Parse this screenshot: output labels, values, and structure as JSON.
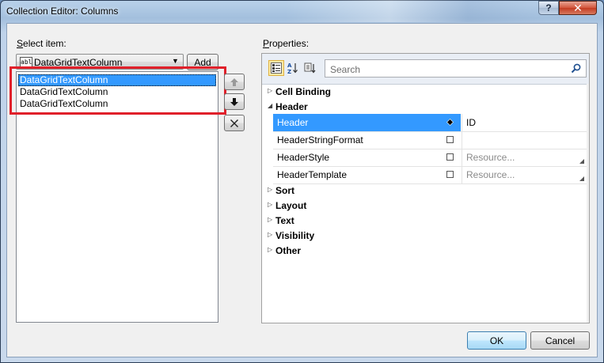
{
  "window": {
    "title": "Collection Editor: Columns",
    "help_label": "?",
    "close_label": "✕"
  },
  "left": {
    "select_label_first": "S",
    "select_label_rest": "elect item:",
    "combo_icon_text": "abl",
    "combo_value": "DataGridTextColumn",
    "add_label": "Add",
    "items": [
      {
        "label": "DataGridTextColumn",
        "selected": true
      },
      {
        "label": "DataGridTextColumn",
        "selected": false
      },
      {
        "label": "DataGridTextColumn",
        "selected": false
      }
    ],
    "highlight_color": "#e0202a"
  },
  "right": {
    "properties_label_first": "P",
    "properties_label_rest": "roperties:",
    "search_placeholder": "Search",
    "categories": [
      {
        "label": "Cell Binding",
        "expanded": false
      },
      {
        "label": "Header",
        "expanded": true
      },
      {
        "label": "Sort",
        "expanded": false
      },
      {
        "label": "Layout",
        "expanded": false
      },
      {
        "label": "Text",
        "expanded": false
      },
      {
        "label": "Visibility",
        "expanded": false
      },
      {
        "label": "Other",
        "expanded": false
      }
    ],
    "header_properties": [
      {
        "name": "Header",
        "value": "ID",
        "selected": true,
        "marker": "diamond",
        "placeholder": false
      },
      {
        "name": "HeaderStringFormat",
        "value": "",
        "selected": false,
        "marker": "square",
        "placeholder": false
      },
      {
        "name": "HeaderStyle",
        "value": "Resource...",
        "selected": false,
        "marker": "square",
        "placeholder": true
      },
      {
        "name": "HeaderTemplate",
        "value": "Resource...",
        "selected": false,
        "marker": "square",
        "placeholder": true
      }
    ],
    "selection_color": "#3399ff"
  },
  "footer": {
    "ok_label": "OK",
    "cancel_label": "Cancel"
  }
}
